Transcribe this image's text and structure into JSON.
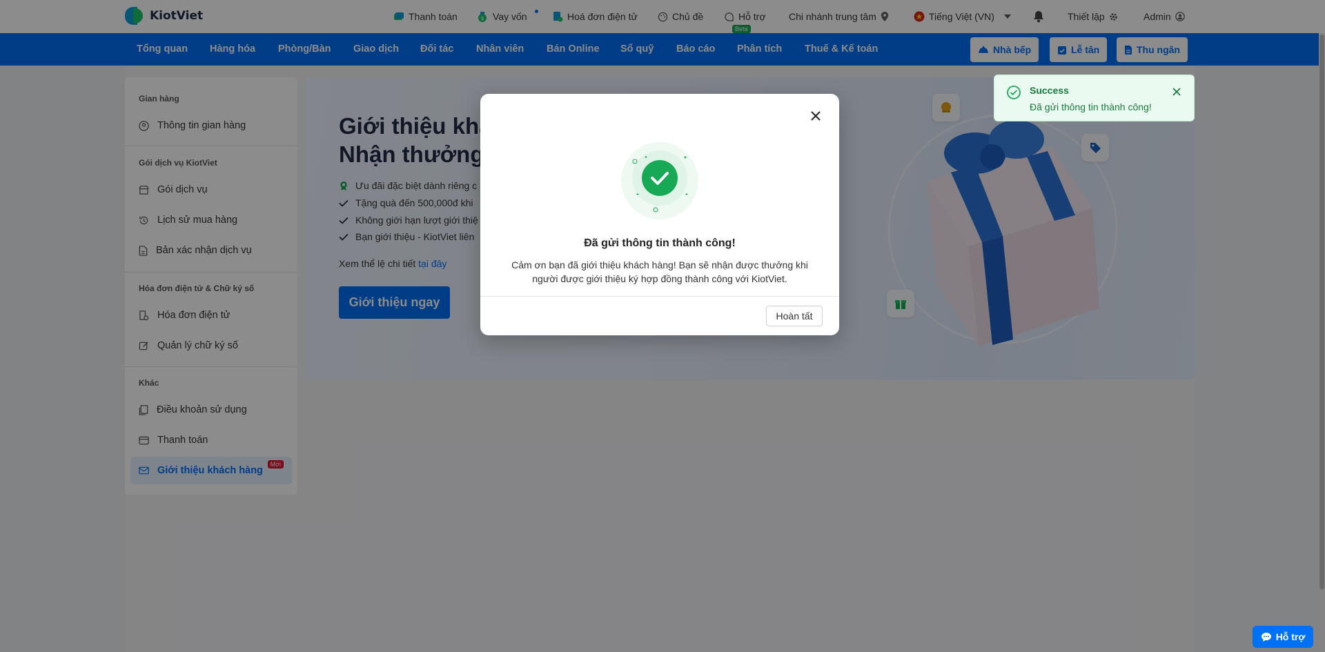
{
  "brand": {
    "name": "KiotViet"
  },
  "topbar": {
    "payment": "Thanh toán",
    "loan": "Vay vốn",
    "einvoice": "Hoá đơn điện tử",
    "theme": "Chủ đề",
    "support": "Hỗ trợ",
    "beta": "Beta",
    "branch": "Chi nhánh trung tâm",
    "language": "Tiếng Việt (VN)",
    "settings": "Thiết lập",
    "user": "Admin"
  },
  "mainnav": {
    "items": [
      "Tổng quan",
      "Hàng hóa",
      "Phòng/Bàn",
      "Giao dịch",
      "Đối tác",
      "Nhân viên",
      "Bán Online",
      "Sổ quỹ",
      "Báo cáo",
      "Phân tích",
      "Thuế & Kế toán"
    ],
    "kitchen": "Nhà bếp",
    "reception": "Lễ tân",
    "cashier": "Thu ngân"
  },
  "sidebar": {
    "groups": [
      {
        "title": "Gian hàng",
        "items": [
          "Thông tin gian hàng"
        ]
      },
      {
        "title": "Gói dịch vụ KiotViet",
        "items": [
          "Gói dịch vụ",
          "Lịch sử mua hàng",
          "Bản xác nhận dịch vụ"
        ]
      },
      {
        "title": "Hóa đơn điện tử & Chữ ký số",
        "items": [
          "Hóa đơn điện tử",
          "Quản lý chữ ký số"
        ]
      },
      {
        "title": "Khác",
        "items": [
          "Điều khoản sử dụng",
          "Thanh toán",
          "Giới thiệu khách hàng"
        ]
      }
    ],
    "new_badge": "Mới"
  },
  "banner": {
    "title_line1": "Giới thiệu kha",
    "title_line2": "Nhận thưởng",
    "lines": [
      "Ưu đãi đặc biệt dành riêng c",
      "Tặng quà đến 500,000đ khi",
      "Không giới hạn lượt giới thiệ",
      "Bạn giới thiệu - KiotViet liên"
    ],
    "detail_prefix": "Xem thể lệ chi tiết",
    "detail_link": "tại đây",
    "cta": "Giới thiệu ngay"
  },
  "toast": {
    "title": "Success",
    "message": "Đã gửi thông tin thành công!"
  },
  "modal": {
    "title": "Đã gửi thông tin thành công!",
    "description": "Cảm ơn bạn đã giới thiệu khách hàng! Bạn sẽ nhận được thưởng khi người được giới thiệu ký hợp đồng thành công với KiotViet.",
    "done": "Hoàn tất"
  },
  "help_button": "Hỗ trợ",
  "colors": {
    "primary": "#0070f4",
    "success": "#18a957",
    "text": "#333333"
  }
}
